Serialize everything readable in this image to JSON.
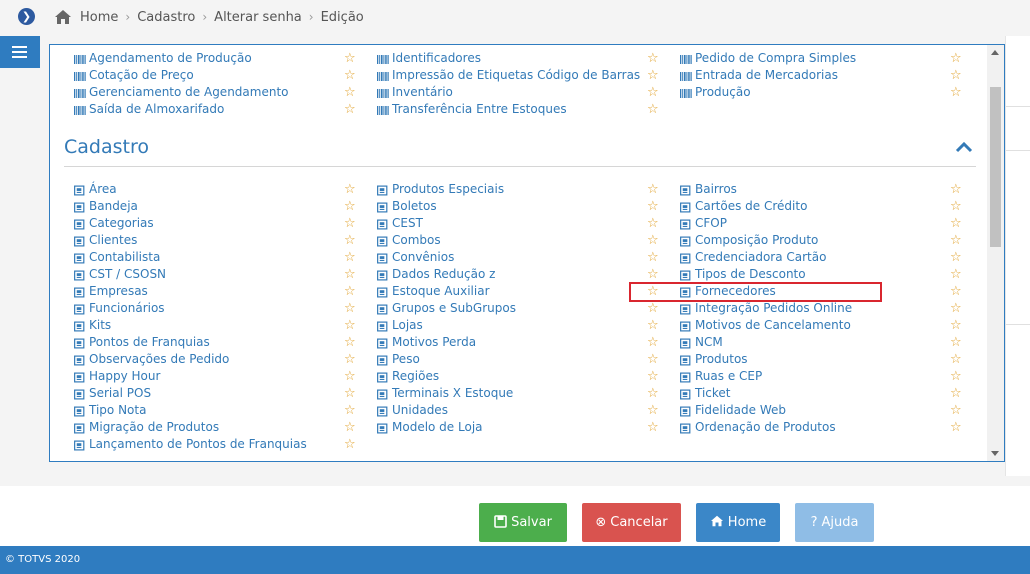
{
  "breadcrumb": [
    "Home",
    "Cadastro",
    "Alterar senha",
    "Edição"
  ],
  "section": {
    "title": "Cadastro"
  },
  "top_columns": [
    [
      "Agendamento de Produção",
      "Cotação de Preço",
      "Gerenciamento de Agendamento",
      "Saída de Almoxarifado"
    ],
    [
      "Identificadores",
      "Impressão de Etiquetas Código de Barras",
      "Inventário",
      "Transferência Entre Estoques"
    ],
    [
      "Pedido de Compra Simples",
      "Entrada de Mercadorias",
      "Produção"
    ]
  ],
  "cadastro_columns": [
    [
      "Área",
      "Bandeja",
      "Categorias",
      "Clientes",
      "Contabilista",
      "CST / CSOSN",
      "Empresas",
      "Funcionários",
      "Kits",
      "Pontos de Franquias",
      "Observações de Pedido",
      "Happy Hour",
      "Serial POS",
      "Tipo Nota",
      "Migração de Produtos",
      "Lançamento de Pontos de Franquias"
    ],
    [
      "Produtos Especiais",
      "Boletos",
      "CEST",
      "Combos",
      "Convênios",
      "Dados Redução z",
      "Estoque Auxiliar",
      "Grupos e SubGrupos",
      "Lojas",
      "Motivos Perda",
      "Peso",
      "Regiões",
      "Terminais X Estoque",
      "Unidades",
      "Modelo de Loja"
    ],
    [
      "Bairros",
      "Cartões de Crédito",
      "CFOP",
      "Composição Produto",
      "Credenciadora Cartão",
      "Tipos de Desconto",
      "Fornecedores",
      "Integração Pedidos Online",
      "Motivos de Cancelamento",
      "NCM",
      "Produtos",
      "Ruas e CEP",
      "Ticket",
      "Fidelidade Web",
      "Ordenação de Produtos"
    ]
  ],
  "buttons": {
    "salvar": "Salvar",
    "cancelar": "Cancelar",
    "home": "Home",
    "ajuda": "Ajuda"
  },
  "footer": {
    "copyright": "© TOTVS 2020"
  },
  "colors": {
    "link": "#337ab7",
    "star": "#e0a12a",
    "highlight": "#d9262f",
    "primary": "#2f7cc0"
  },
  "icons": {
    "top_items": "barcode-icon",
    "cadastro_items": "form-icon",
    "favorite": "star-outline-icon"
  }
}
